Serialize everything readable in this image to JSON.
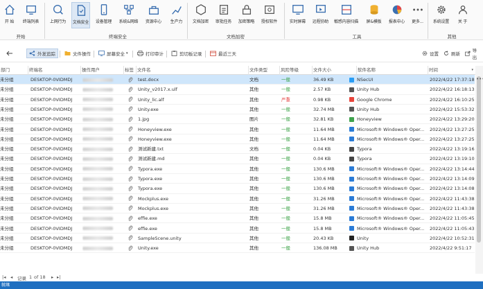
{
  "ribbon": {
    "buttons": [
      {
        "label": "开 始",
        "icon": "home-icon"
      },
      {
        "label": "终端列表",
        "icon": "terminal-list-icon"
      },
      {
        "label": "上网行为",
        "icon": "web-behavior-icon"
      },
      {
        "label": "文档安全",
        "icon": "document-security-icon"
      },
      {
        "label": "设备管理",
        "icon": "device-management-icon"
      },
      {
        "label": "系统&网络",
        "icon": "system-network-icon"
      },
      {
        "label": "资源中心",
        "icon": "resource-center-icon"
      },
      {
        "label": "生产力",
        "icon": "productivity-icon"
      },
      {
        "label": "文档加密",
        "icon": "document-encrypt-icon"
      },
      {
        "label": "审批任务",
        "icon": "approval-task-icon"
      },
      {
        "label": "加密策略",
        "icon": "encrypt-policy-icon"
      },
      {
        "label": "授权软件",
        "icon": "authorized-software-icon"
      },
      {
        "label": "实时屏幕",
        "icon": "realtime-screen-icon"
      },
      {
        "label": "远程协助",
        "icon": "remote-assist-icon"
      },
      {
        "label": "敏感内容扫描",
        "icon": "sensitive-scan-icon"
      },
      {
        "label": "屏&模板",
        "icon": "template-icon"
      },
      {
        "label": "报表中心",
        "icon": "report-center-icon"
      },
      {
        "label": "更多...",
        "icon": "more-icon"
      },
      {
        "label": "系统设置",
        "icon": "gear-icon"
      },
      {
        "label": "关 于",
        "icon": "about-icon"
      }
    ],
    "groups": [
      "开始",
      "终端安全",
      "文档加密",
      "工具",
      "其他"
    ]
  },
  "toolbar": {
    "items": [
      {
        "label": "外发追踪"
      },
      {
        "label": "文件操作"
      },
      {
        "label": "屏幕安全"
      },
      {
        "label": "打印审计"
      },
      {
        "label": "剪切板记录"
      },
      {
        "label": "最近三天"
      }
    ],
    "settings": "设置",
    "refresh": "刷新",
    "export": "导出"
  },
  "table": {
    "columns": [
      "部门",
      "终端名",
      "操作用户",
      "标签",
      "文件名",
      "文件类型",
      "风险等级",
      "文件大小",
      "软件名称",
      "时间"
    ],
    "rows": [
      {
        "dept": "未分组",
        "terminal": "DESKTOP-0VIDMDJ",
        "file": "test.docx",
        "type": "文档",
        "risk": "一般",
        "size": "36.49 KB",
        "software": "NSecUI",
        "sw_icon": "nsecui",
        "time": "2022/4/22 17:37:18",
        "selected": true
      },
      {
        "dept": "未分组",
        "terminal": "DESKTOP-0VIDMDJ",
        "file": "Unity_v2017.x.ulf",
        "type": "其他",
        "risk": "一般",
        "size": "2.57 KB",
        "software": "Unity Hub",
        "sw_icon": "unity",
        "time": "2022/4/22 16:18:13"
      },
      {
        "dept": "未分组",
        "terminal": "DESKTOP-0VIDMDJ",
        "file": "Unity_lic.alf",
        "type": "其他",
        "risk": "严重",
        "size": "0.98 KB",
        "software": "Google Chrome",
        "sw_icon": "chrome",
        "time": "2022/4/22 16:10:25"
      },
      {
        "dept": "未分组",
        "terminal": "DESKTOP-0VIDMDJ",
        "file": "Unity.exe",
        "type": "其他",
        "risk": "一般",
        "size": "32.74 MB",
        "software": "Unity Hub",
        "sw_icon": "unity",
        "time": "2022/4/22 15:53:32"
      },
      {
        "dept": "未分组",
        "terminal": "DESKTOP-0VIDMDJ",
        "file": "1.jpg",
        "type": "图片",
        "risk": "一般",
        "size": "32.81 KB",
        "software": "Honeyview",
        "sw_icon": "honey",
        "time": "2022/4/22 13:29:20"
      },
      {
        "dept": "未分组",
        "terminal": "DESKTOP-0VIDMDJ",
        "file": "Honeyview.exe",
        "type": "其他",
        "risk": "一般",
        "size": "11.64 MB",
        "software": "Microsoft® Windows® Oper...",
        "sw_icon": "windows",
        "time": "2022/4/22 13:27:25"
      },
      {
        "dept": "未分组",
        "terminal": "DESKTOP-0VIDMDJ",
        "file": "Honeyview.exe",
        "type": "其他",
        "risk": "一般",
        "size": "11.64 MB",
        "software": "Microsoft® Windows® Oper...",
        "sw_icon": "windows",
        "time": "2022/4/22 13:27:25"
      },
      {
        "dept": "未分组",
        "terminal": "DESKTOP-0VIDMDJ",
        "file": "测试新建.txt",
        "type": "文档",
        "risk": "一般",
        "size": "0.04 KB",
        "software": "Typora",
        "sw_icon": "typora",
        "time": "2022/4/22 13:19:16"
      },
      {
        "dept": "未分组",
        "terminal": "DESKTOP-0VIDMDJ",
        "file": "测试新建.md",
        "type": "其他",
        "risk": "一般",
        "size": "0.04 KB",
        "software": "Typora",
        "sw_icon": "typora",
        "time": "2022/4/22 13:19:10"
      },
      {
        "dept": "未分组",
        "terminal": "DESKTOP-0VIDMDJ",
        "file": "Typora.exe",
        "type": "其他",
        "risk": "一般",
        "size": "130.6 MB",
        "software": "Microsoft® Windows® Oper...",
        "sw_icon": "windows",
        "time": "2022/4/22 13:14:44"
      },
      {
        "dept": "未分组",
        "terminal": "DESKTOP-0VIDMDJ",
        "file": "Typora.exe",
        "type": "其他",
        "risk": "一般",
        "size": "130.6 MB",
        "software": "Microsoft® Windows® Oper...",
        "sw_icon": "windows",
        "time": "2022/4/22 13:14:09"
      },
      {
        "dept": "未分组",
        "terminal": "DESKTOP-0VIDMDJ",
        "file": "Typora.exe",
        "type": "其他",
        "risk": "一般",
        "size": "130.6 MB",
        "software": "Microsoft® Windows® Oper...",
        "sw_icon": "windows",
        "time": "2022/4/22 13:14:08"
      },
      {
        "dept": "未分组",
        "terminal": "DESKTOP-0VIDMDJ",
        "file": "Mockplus.exe",
        "type": "其他",
        "risk": "一般",
        "size": "31.26 MB",
        "software": "Microsoft® Windows® Oper...",
        "sw_icon": "windows",
        "time": "2022/4/22 11:43:38"
      },
      {
        "dept": "未分组",
        "terminal": "DESKTOP-0VIDMDJ",
        "file": "Mockplus.exe",
        "type": "其他",
        "risk": "一般",
        "size": "31.26 MB",
        "software": "Microsoft® Windows® Oper...",
        "sw_icon": "windows",
        "time": "2022/4/22 11:43:38"
      },
      {
        "dept": "未分组",
        "terminal": "DESKTOP-0VIDMDJ",
        "file": "effie.exe",
        "type": "其他",
        "risk": "一般",
        "size": "15.8 MB",
        "software": "Microsoft® Windows® Oper...",
        "sw_icon": "windows",
        "time": "2022/4/22 11:05:45"
      },
      {
        "dept": "未分组",
        "terminal": "DESKTOP-0VIDMDJ",
        "file": "effie.exe",
        "type": "其他",
        "risk": "一般",
        "size": "15.8 MB",
        "software": "Microsoft® Windows® Oper...",
        "sw_icon": "windows",
        "time": "2022/4/22 11:05:43"
      },
      {
        "dept": "未分组",
        "terminal": "DESKTOP-0VIDMDJ",
        "file": "SampleScene.unity",
        "type": "其他",
        "risk": "一般",
        "size": "20.43 KB",
        "software": "Unity",
        "sw_icon": "unityblack",
        "time": "2022/4/22 10:52:31"
      },
      {
        "dept": "未分组",
        "terminal": "DESKTOP-0VIDMDJ",
        "file": "Unity.exe",
        "type": "其他",
        "risk": "一般",
        "size": "136.08 MB",
        "software": "Unity Hub",
        "sw_icon": "unity",
        "time": "2022/4/22 9:51:17"
      }
    ]
  },
  "pager": {
    "prefix": "记录",
    "page": "1",
    "of": "of 18"
  },
  "status": {
    "text": "就绪"
  },
  "colors": {
    "accent": "#1f6fc0",
    "selected_row": "#cfe6fb",
    "risk_low": "#2e9b3a",
    "risk_high": "#e54545"
  }
}
